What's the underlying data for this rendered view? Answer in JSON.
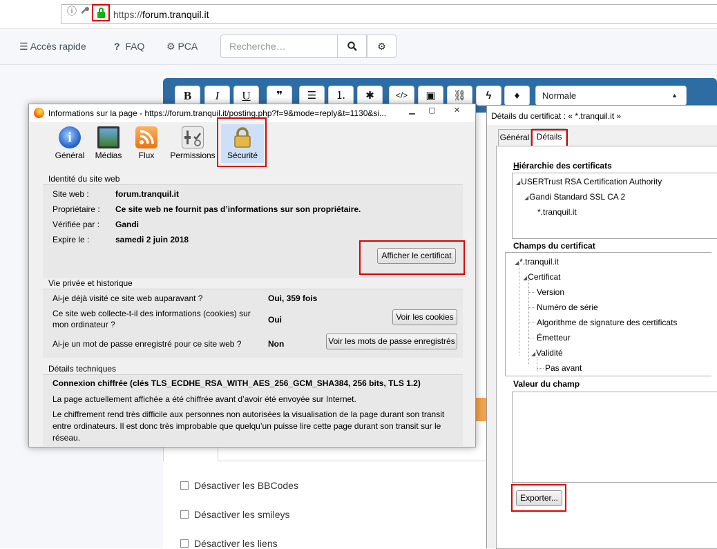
{
  "browser": {
    "url_prefix": "https://",
    "url_host": "forum.tranquil.it",
    "info_icon": "ⓘ",
    "key_icon": "🔑"
  },
  "forum_nav": {
    "quick_access": "Accès rapide",
    "faq": "FAQ",
    "pca": "PCA",
    "search_placeholder": "Recherche…",
    "search_icon": "magnifier",
    "settings_icon": "gear"
  },
  "editor": {
    "buttons": [
      "B",
      "I",
      "U",
      "❞",
      "☰",
      "⒈",
      "✱",
      "</>",
      "▣",
      "⛓",
      "ϟ",
      "♦"
    ],
    "format_select": "Normale"
  },
  "editor_options": {
    "disable_bbcode": "Désactiver les BBCodes",
    "disable_smileys": "Désactiver les smileys",
    "disable_links": "Désactiver les liens"
  },
  "page_info_dialog": {
    "title": "Informations sur la page - https://forum.tranquil.it/posting.php?f=9&mode=reply&t=1130&si...",
    "window_buttons": [
      "▁",
      "▢",
      "✕"
    ],
    "tabs": [
      {
        "label": "Général",
        "icon": "info-icon"
      },
      {
        "label": "Médias",
        "icon": "media-icon"
      },
      {
        "label": "Flux",
        "icon": "rss-icon"
      },
      {
        "label": "Permissions",
        "icon": "permissions-icon"
      },
      {
        "label": "Sécurité",
        "icon": "padlock-icon"
      }
    ],
    "identity": {
      "heading": "Identité du site web",
      "site_label": "Site web :",
      "site_value": "forum.tranquil.it",
      "owner_label": "Propriétaire :",
      "owner_value": "Ce site web ne fournit pas d’informations sur son propriétaire.",
      "verified_label": "Vérifiée par :",
      "verified_value": "Gandi",
      "expires_label": "Expire le :",
      "expires_value": "samedi 2 juin 2018",
      "view_cert_button": "Afficher le certificat"
    },
    "privacy": {
      "heading": "Vie privée et historique",
      "visited_q": "Ai-je déjà visité ce site web auparavant ?",
      "visited_a": "Oui, 359 fois",
      "cookies_q_line1": "Ce site web collecte-t-il des informations (cookies) sur",
      "cookies_q_line2": "mon ordinateur ?",
      "cookies_a": "Oui",
      "view_cookies_button": "Voir les cookies",
      "password_q": "Ai-je un mot de passe enregistré pour ce site web ?",
      "password_a": "Non",
      "view_passwords_button": "Voir les mots de passe enregistrés"
    },
    "technical": {
      "heading": "Détails techniques",
      "connection": "Connexion chiffrée (clés TLS_ECDHE_RSA_WITH_AES_256_GCM_SHA384, 256 bits, TLS 1.2)",
      "line1": "La page actuellement affichée a été chiffrée avant d’avoir été envoyée sur Internet.",
      "line2": "Le chiffrement rend très difficile aux personnes non autorisées la visualisation de la page durant son transit",
      "line3": "entre ordinateurs. Il est donc très improbable que quelqu’un puisse lire cette page durant son transit sur le",
      "line4": "réseau."
    }
  },
  "cert_dialog": {
    "title": "Détails du certificat : « *.tranquil.it »",
    "tab_general": "Général",
    "tab_details": "Détails",
    "hierarchy_heading": "Hiérarchie des certificats",
    "hierarchy": [
      "USERTrust RSA Certification Authority",
      "Gandi Standard SSL CA 2",
      "*.tranquil.it"
    ],
    "fields_heading": "Champs du certificat",
    "fields": [
      "*.tranquil.it",
      "Certificat",
      "Version",
      "Numéro de série",
      "Algorithme de signature des certificats",
      "Émetteur",
      "Validité",
      "Pas avant"
    ],
    "value_heading": "Valeur du champ",
    "export_button": "Exporter..."
  },
  "colors": {
    "highlight_red": "#e00000",
    "editor_blue": "#2e6ca4",
    "lock_green": "#12b312"
  }
}
